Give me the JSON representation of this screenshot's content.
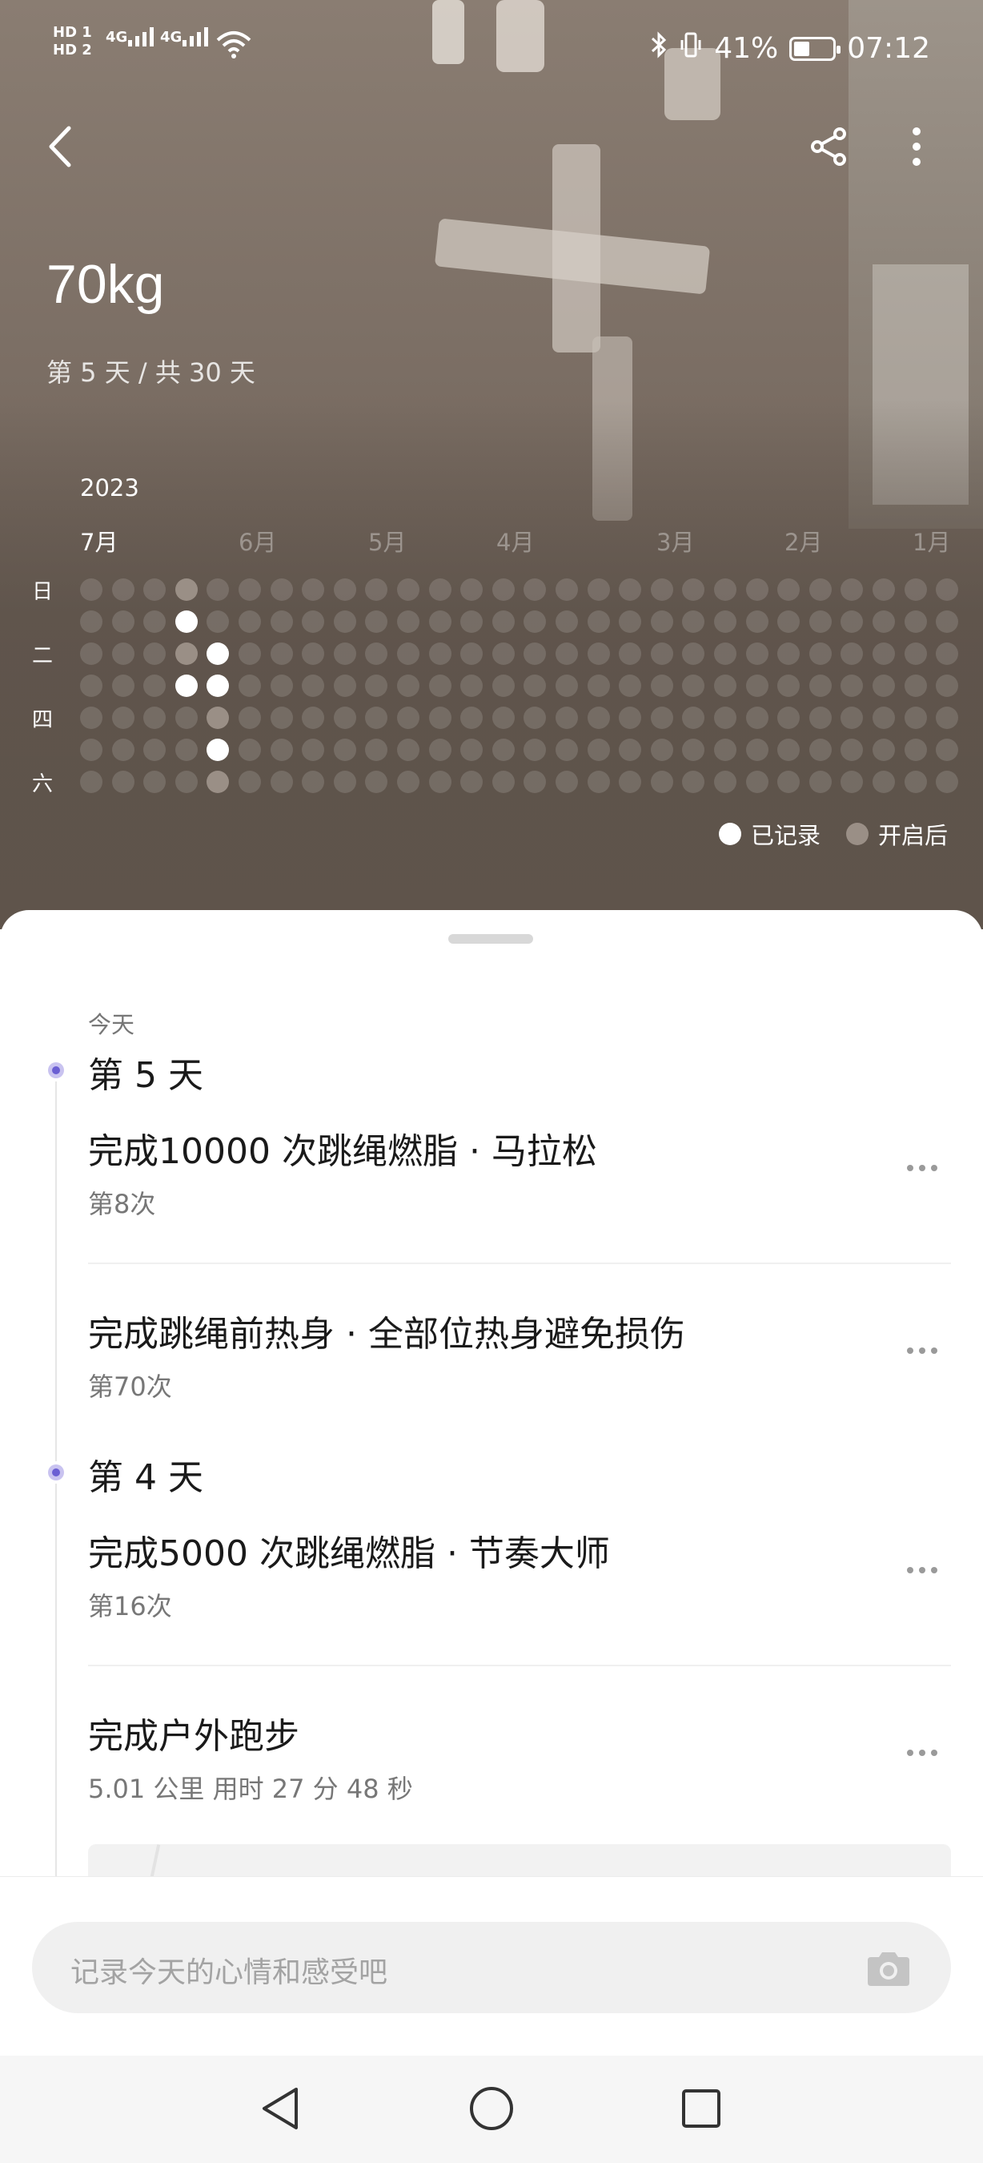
{
  "status_bar": {
    "sim1": "HD 1",
    "sim2": "HD 2",
    "net1": "4G",
    "net2": "4G",
    "battery_percent": "41%",
    "battery_level": 0.41,
    "time": "07:12",
    "icons": [
      "bluetooth-icon",
      "vibrate-icon",
      "wifi-icon",
      "battery-icon"
    ]
  },
  "toolbar": {
    "back_icon": "back-arrow-icon",
    "share_icon": "share-icon",
    "more_icon": "more-vertical-icon"
  },
  "goal": {
    "title": "70kg",
    "progress": "第 5 天 / 共 30 天",
    "current_day": 5,
    "total_days": 30
  },
  "calendar": {
    "year": "2023",
    "months": [
      "7月",
      "6月",
      "5月",
      "4月",
      "3月",
      "2月",
      "1月"
    ],
    "current_month": "7月",
    "weekday_labels": [
      "日",
      "二",
      "四",
      "六"
    ],
    "recorded_cells": [
      [
        3,
        1
      ],
      [
        3,
        3
      ],
      [
        4,
        2
      ],
      [
        4,
        3
      ],
      [
        4,
        5
      ]
    ],
    "started_cells": [
      [
        3,
        0
      ],
      [
        3,
        2
      ],
      [
        4,
        4
      ],
      [
        4,
        6
      ]
    ],
    "legend": {
      "recorded": "已记录",
      "started": "开启后"
    },
    "colors": {
      "recorded": "#ffffff",
      "started": "#9a8f86",
      "empty": "rgba(255,255,255,0.14)"
    }
  },
  "timeline": {
    "today_label": "今天",
    "days": [
      {
        "label": "第 5 天",
        "entries": [
          {
            "title": "完成10000 次跳绳燃脂 · 马拉松",
            "sub": "第8次"
          },
          {
            "title": "完成跳绳前热身 · 全部位热身避免损伤",
            "sub": "第70次"
          }
        ]
      },
      {
        "label": "第 4 天",
        "entries": [
          {
            "title": "完成5000 次跳绳燃脂 · 节奏大师",
            "sub": "第16次"
          },
          {
            "title": "完成户外跑步",
            "sub": "5.01 公里 用时 27 分 48 秒"
          }
        ]
      }
    ],
    "accent_color": "#6b5fd3"
  },
  "composer": {
    "placeholder": "记录今天的心情和感受吧",
    "camera_icon": "camera-icon"
  },
  "nav": {
    "back_icon": "nav-back-triangle-icon",
    "home_icon": "nav-home-circle-icon",
    "recents_icon": "nav-recents-square-icon"
  }
}
